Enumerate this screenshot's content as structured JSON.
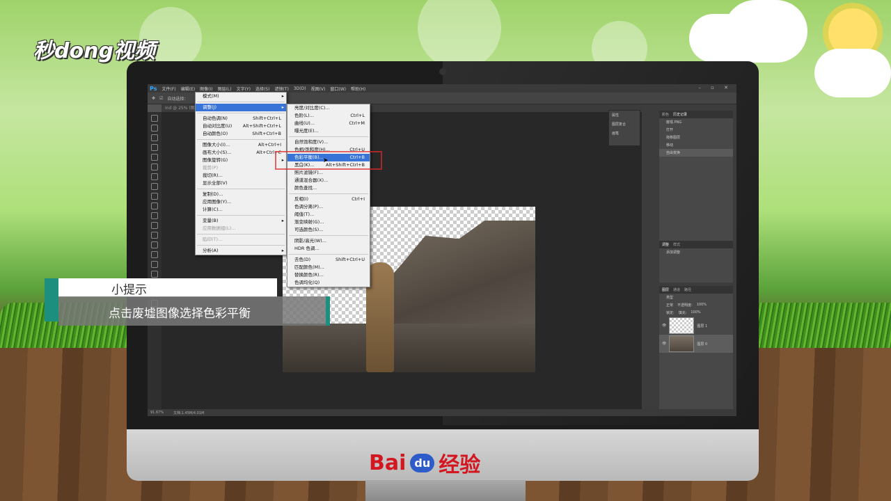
{
  "brand": {
    "logo_text": "秒dong视频",
    "footer_brand": "Bai",
    "footer_du": "du",
    "footer_suffix": "经验"
  },
  "ps": {
    "app_icon": "Ps",
    "menubar": [
      "文件(F)",
      "编辑(E)",
      "图像(I)",
      "图层(L)",
      "文字(Y)",
      "选择(S)",
      "滤镜(T)",
      "3D(D)",
      "视图(V)",
      "窗口(W)",
      "帮助(H)"
    ],
    "option_label": "自动选择：",
    "doc_tab": "ind @ 25% (图层 0, RGB/8)",
    "status_zoom": "91.67%",
    "status_doc": "文档:1.45M/4.01M",
    "panel_tabs": {
      "color": "颜色",
      "history": "历史记录",
      "adjust": "调整",
      "styles": "样式",
      "layers": "图层",
      "channels": "通道",
      "paths": "路径"
    },
    "mini_panel": [
      "属性",
      "图层复合",
      "画笔"
    ],
    "history": {
      "snapshot": "废墟.PNG",
      "items": [
        "打开",
        "拖移图层",
        "移动",
        "自由变换"
      ]
    },
    "adjust_label": "添加调整",
    "layers_panel": {
      "kind": "类型",
      "blend": "正常",
      "opacity_label": "不透明度:",
      "opacity": "100%",
      "lock_label": "锁定:",
      "fill_label": "填充:",
      "fill": "100%",
      "items": [
        "图层 1",
        "图层 0"
      ]
    }
  },
  "image_menu": {
    "items": [
      {
        "label": "模式(M)",
        "shortcut": "",
        "sub": true
      },
      {
        "sep": true
      },
      {
        "label": "调整(J)",
        "shortcut": "",
        "sub": true,
        "hl": true
      },
      {
        "sep": true
      },
      {
        "label": "自动色调(N)",
        "shortcut": "Shift+Ctrl+L"
      },
      {
        "label": "自动对比度(U)",
        "shortcut": "Alt+Shift+Ctrl+L"
      },
      {
        "label": "自动颜色(O)",
        "shortcut": "Shift+Ctrl+B"
      },
      {
        "sep": true
      },
      {
        "label": "图像大小(I)...",
        "shortcut": "Alt+Ctrl+I"
      },
      {
        "label": "画布大小(S)...",
        "shortcut": "Alt+Ctrl+C"
      },
      {
        "label": "图像旋转(G)",
        "shortcut": "",
        "sub": true
      },
      {
        "label": "裁剪(P)",
        "shortcut": "",
        "dis": true
      },
      {
        "label": "裁切(R)...",
        "shortcut": ""
      },
      {
        "label": "显示全部(V)",
        "shortcut": ""
      },
      {
        "sep": true
      },
      {
        "label": "复制(D)...",
        "shortcut": ""
      },
      {
        "label": "应用图像(Y)...",
        "shortcut": ""
      },
      {
        "label": "计算(C)...",
        "shortcut": ""
      },
      {
        "sep": true
      },
      {
        "label": "变量(B)",
        "shortcut": "",
        "sub": true
      },
      {
        "label": "应用数据组(L)...",
        "shortcut": "",
        "dis": true
      },
      {
        "sep": true
      },
      {
        "label": "陷印(T)...",
        "shortcut": "",
        "dis": true
      },
      {
        "sep": true
      },
      {
        "label": "分析(A)",
        "shortcut": "",
        "sub": true
      }
    ]
  },
  "adjust_menu": {
    "items": [
      {
        "label": "亮度/对比度(C)...",
        "shortcut": ""
      },
      {
        "label": "色阶(L)...",
        "shortcut": "Ctrl+L"
      },
      {
        "label": "曲线(U)...",
        "shortcut": "Ctrl+M"
      },
      {
        "label": "曝光度(E)...",
        "shortcut": ""
      },
      {
        "sep": true
      },
      {
        "label": "自然饱和度(V)...",
        "shortcut": ""
      },
      {
        "label": "色相/饱和度(H)...",
        "shortcut": "Ctrl+U"
      },
      {
        "label": "色彩平衡(B)...",
        "shortcut": "Ctrl+B",
        "hl": true
      },
      {
        "label": "黑白(K)...",
        "shortcut": "Alt+Shift+Ctrl+B"
      },
      {
        "label": "照片滤镜(F)...",
        "shortcut": ""
      },
      {
        "label": "通道混合器(X)...",
        "shortcut": ""
      },
      {
        "label": "颜色查找...",
        "shortcut": ""
      },
      {
        "sep": true
      },
      {
        "label": "反相(I)",
        "shortcut": "Ctrl+I"
      },
      {
        "label": "色调分离(P)...",
        "shortcut": ""
      },
      {
        "label": "阈值(T)...",
        "shortcut": ""
      },
      {
        "label": "渐变映射(G)...",
        "shortcut": ""
      },
      {
        "label": "可选颜色(S)...",
        "shortcut": ""
      },
      {
        "sep": true
      },
      {
        "label": "阴影/高光(W)...",
        "shortcut": ""
      },
      {
        "label": "HDR 色调...",
        "shortcut": ""
      },
      {
        "sep": true
      },
      {
        "label": "去色(D)",
        "shortcut": "Shift+Ctrl+U"
      },
      {
        "label": "匹配颜色(M)...",
        "shortcut": ""
      },
      {
        "label": "替换颜色(R)...",
        "shortcut": ""
      },
      {
        "label": "色调均化(Q)",
        "shortcut": ""
      }
    ]
  },
  "tip": {
    "title": "小提示",
    "text": "点击废墟图像选择色彩平衡"
  }
}
